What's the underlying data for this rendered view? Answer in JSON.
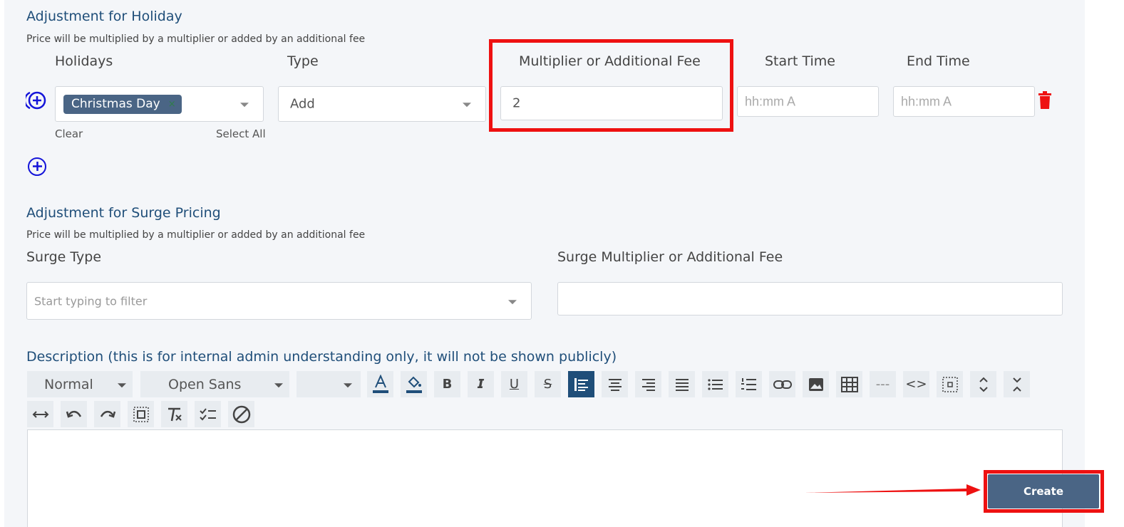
{
  "holiday": {
    "title": "Adjustment for Holiday",
    "subtitle": "Price will be multiplied by a multiplier or added by an additional fee",
    "columns": {
      "holidays": "Holidays",
      "type": "Type",
      "multiplier": "Multiplier or Additional Fee",
      "start_time": "Start Time",
      "end_time": "End Time"
    },
    "row": {
      "selected_holiday": "Christmas Day",
      "chip_remove": "×",
      "type_value": "Add",
      "multiplier_value": "2",
      "start_placeholder": "hh:mm A",
      "end_placeholder": "hh:mm A",
      "clear_label": "Clear",
      "select_all_label": "Select All"
    }
  },
  "surge": {
    "title": "Adjustment for Surge Pricing",
    "subtitle": "Price will be multiplied by a multiplier or added by an additional fee",
    "surge_type_label": "Surge Type",
    "surge_type_placeholder": "Start typing to filter",
    "fee_label": "Surge Multiplier or Additional Fee",
    "fee_value": ""
  },
  "description": {
    "label": "Description (this is for internal admin understanding only, it will not be shown publicly)",
    "toolbar": {
      "paragraph_style": "Normal",
      "font_family": "Open Sans",
      "font_size": ""
    }
  },
  "actions": {
    "create_label": "Create"
  },
  "colors": {
    "accent": "#1f4e79",
    "button": "#4a6585",
    "highlight": "#ee1111",
    "plus_icon": "#1414d9",
    "trash_icon": "#ee1111"
  }
}
